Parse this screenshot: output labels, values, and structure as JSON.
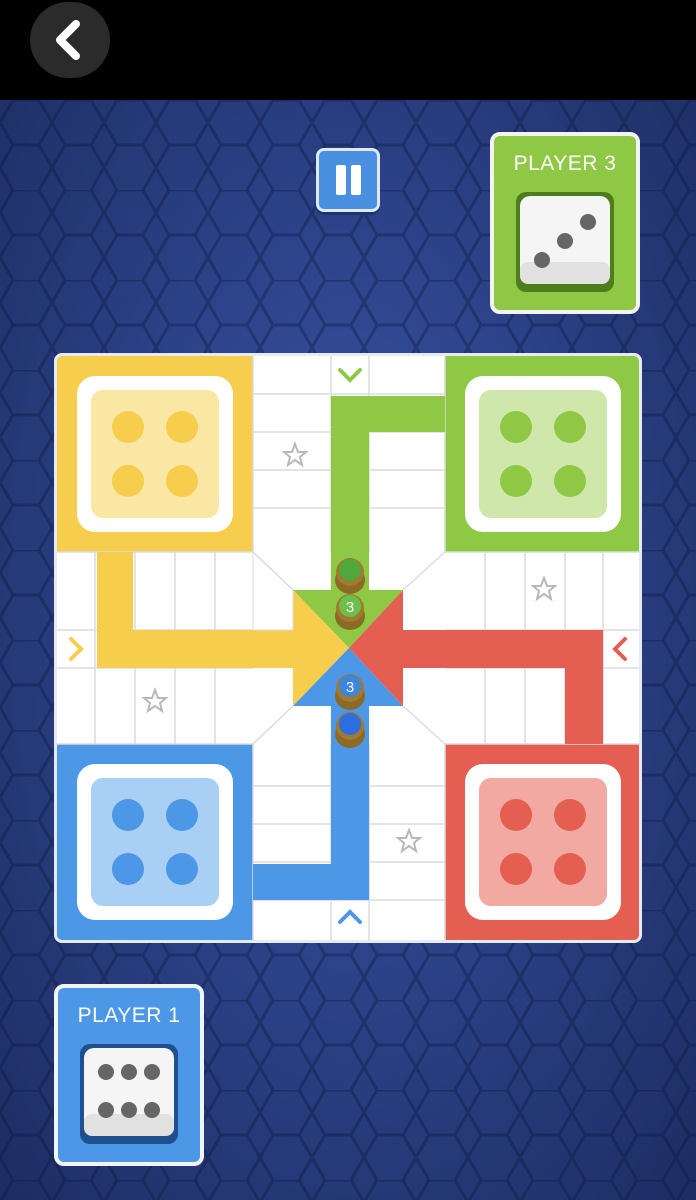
{
  "top_bar": {
    "back_icon": "chevron-left-icon"
  },
  "controls": {
    "pause_icon": "pause-icon"
  },
  "players": [
    {
      "id": "player-3",
      "label": "PLAYER 3",
      "color": "#8fc844",
      "die_value": 3
    },
    {
      "id": "player-1",
      "label": "PLAYER 1",
      "color": "#4c97e6",
      "die_value": 6
    }
  ],
  "board": {
    "colors": {
      "yellow": "#f6cd4d",
      "green": "#8fc844",
      "red": "#e45f52",
      "blue": "#4c97e6"
    },
    "home_dice_value": 4,
    "center_tokens": [
      {
        "color": "green",
        "label": "",
        "position": "top"
      },
      {
        "color": "green",
        "label": "3",
        "position": "top-inner"
      },
      {
        "color": "blue",
        "label": "3",
        "position": "bottom-inner"
      },
      {
        "color": "blue",
        "label": "",
        "position": "bottom"
      }
    ],
    "start_arrows": [
      "green-arrow-down-icon",
      "red-arrow-left-icon",
      "blue-arrow-up-icon",
      "yellow-arrow-right-icon"
    ],
    "safe_star_icons": 4
  }
}
